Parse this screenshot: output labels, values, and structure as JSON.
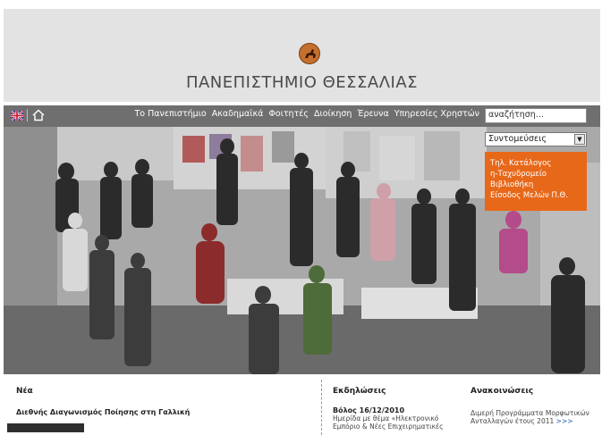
{
  "header": {
    "title": "ΠΑΝΕΠΙΣΤΗΜΙΟ ΘΕΣΣΑΛΙΑΣ",
    "logo_icon": "centaur-emblem-icon"
  },
  "navbar": {
    "items": [
      "Το Πανεπιστήμιο",
      "Ακαδημαϊκά",
      "Φοιτητές",
      "Διοίκηση",
      "Έρευνα",
      "Υπηρεσίες Χρηστών"
    ],
    "search_placeholder": "αναζήτηση...",
    "flag_icon": "uk-flag-icon",
    "home_icon": "home-icon"
  },
  "shortcuts": {
    "selected": "Συντομεύσεις",
    "menu": [
      "Τηλ. Κατάλογος",
      "η-Ταχυδρομείο",
      "Βιβλιοθήκη",
      "Είσοδος Μελών Π.Θ."
    ],
    "menu_color": "#e8681a"
  },
  "news": {
    "heading": "Νέα",
    "title": "Διεθνής Διαγωνισμός Ποίησης στη Γαλλική"
  },
  "events": {
    "heading": "Εκδηλώσεις",
    "date": "Βόλος 16/12/2010",
    "text_line1": "Ημερίδα με θέμα «Ηλεκτρονικό",
    "text_line2": "Εμπόριο & Νέες Επιχειρηματικές"
  },
  "announcements": {
    "heading": "Ανακοινώσεις",
    "text_line1": "Διμερή Προγράμματα Μορφωτικών",
    "text_line2": "Ανταλλαγών έτους 2011",
    "more_link": ">>>"
  }
}
